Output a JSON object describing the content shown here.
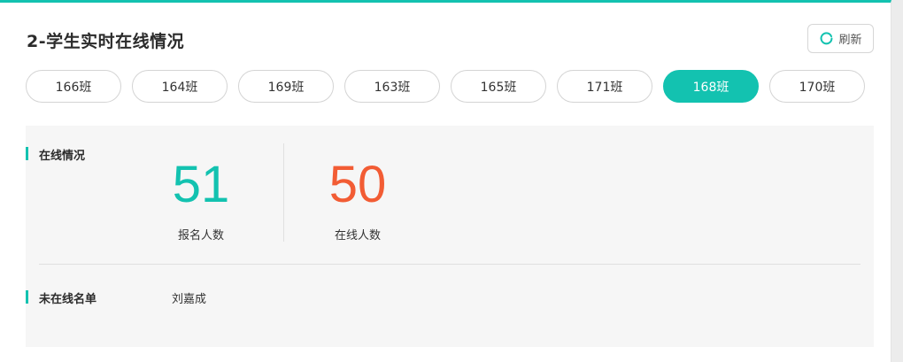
{
  "header": {
    "title": "2-学生实时在线情况",
    "refresh_label": "刷新"
  },
  "tabs": [
    {
      "label": "166班",
      "active": false
    },
    {
      "label": "164班",
      "active": false
    },
    {
      "label": "169班",
      "active": false
    },
    {
      "label": "163班",
      "active": false
    },
    {
      "label": "165班",
      "active": false
    },
    {
      "label": "171班",
      "active": false
    },
    {
      "label": "168班",
      "active": true
    },
    {
      "label": "170班",
      "active": false
    }
  ],
  "online": {
    "section_title": "在线情况",
    "registered": {
      "value": "51",
      "label": "报名人数"
    },
    "online_now": {
      "value": "50",
      "label": "在线人数"
    }
  },
  "offline": {
    "section_title": "未在线名单",
    "names": [
      "刘嘉成"
    ]
  },
  "colors": {
    "accent": "#13c2b0",
    "online_count": "#f25c34"
  },
  "icons": {
    "refresh": "refresh-icon"
  }
}
